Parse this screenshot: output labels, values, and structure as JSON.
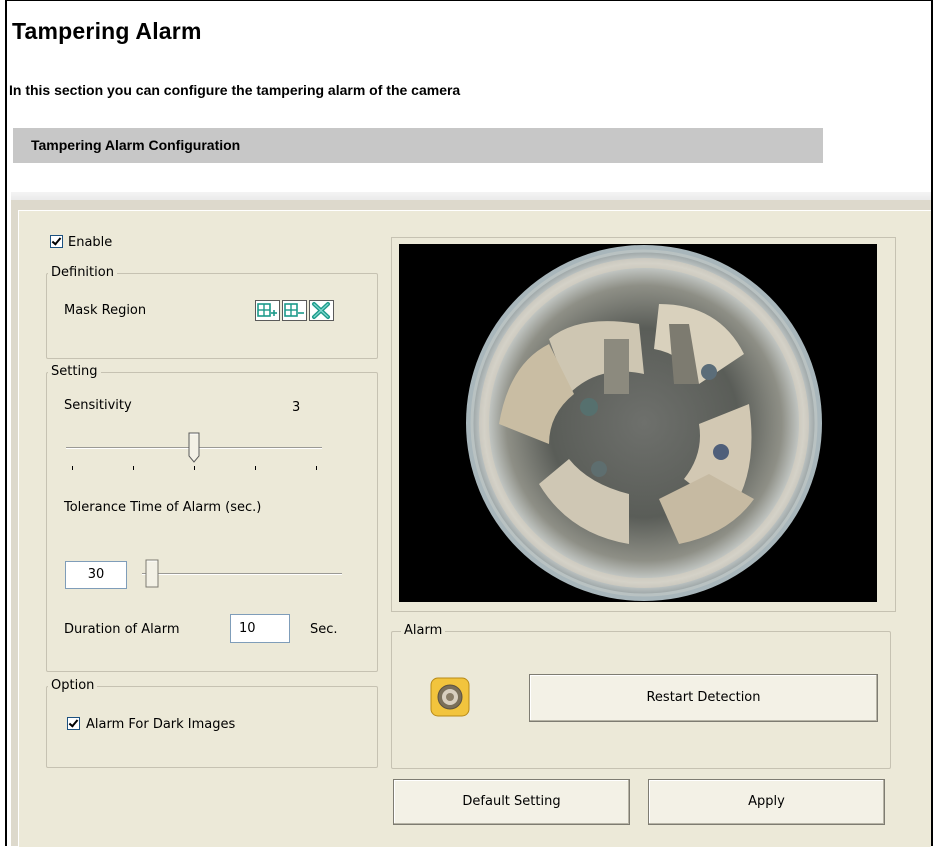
{
  "page": {
    "title": "Tampering Alarm",
    "description": "In this section you can configure the tampering alarm of the camera",
    "section_title": "Tampering Alarm Configuration"
  },
  "enable": {
    "label": "Enable",
    "checked": true
  },
  "definition": {
    "legend": "Definition",
    "mask_region_label": "Mask Region",
    "tools": [
      "add-region-icon",
      "remove-region-icon",
      "clear-region-icon"
    ]
  },
  "setting": {
    "legend": "Setting",
    "sensitivity_label": "Sensitivity",
    "sensitivity_value": "3",
    "sensitivity_level": 3,
    "sensitivity_max": 5,
    "tolerance_label": "Tolerance Time of Alarm (sec.)",
    "tolerance_value": "30",
    "duration_label": "Duration of Alarm",
    "duration_value": "10",
    "duration_unit": "Sec."
  },
  "option": {
    "legend": "Option",
    "dark_images_label": "Alarm For Dark Images",
    "dark_images_checked": true
  },
  "preview": {
    "icon": "fisheye-camera-preview"
  },
  "alarm": {
    "legend": "Alarm",
    "indicator_icon": "alarm-indicator-icon",
    "restart_label": "Restart Detection"
  },
  "buttons": {
    "default_label": "Default Setting",
    "apply_label": "Apply"
  },
  "colors": {
    "section_bar": "#c7c7c7",
    "panel_bg": "#ece9d8",
    "tool_icon": "#1c9a8a",
    "alarm_indicator": "#f2c43d"
  }
}
